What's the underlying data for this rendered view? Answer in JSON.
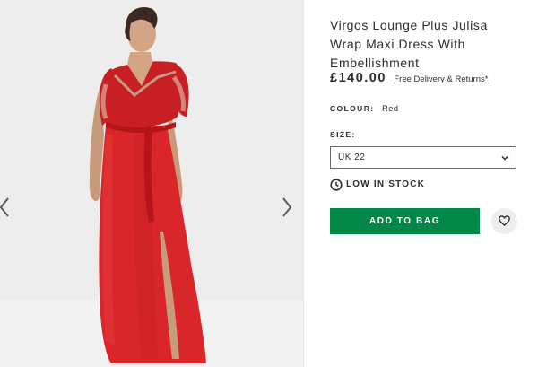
{
  "product": {
    "title": "Virgos Lounge Plus Julisa Wrap Maxi Dress With Embellishment",
    "price": "£140.00",
    "delivery_link": "Free Delivery & Returns*",
    "colour_label": "COLOUR:",
    "colour_value": "Red",
    "size_label": "SIZE:",
    "size_selected": "UK 22",
    "stock_text": "LOW IN STOCK",
    "add_to_bag": "ADD TO BAG"
  },
  "gallery": {
    "image_subject": "model-wearing-red-maxi-dress",
    "prev_icon": "chevron-left-icon",
    "next_icon": "chevron-right-icon"
  },
  "icons": {
    "size_dropdown": "chevron-down-icon",
    "stock": "clock-icon",
    "save": "heart-icon"
  },
  "colors": {
    "accent_green": "#018849",
    "dress_red": "#d8262a",
    "text": "#2d2d2d",
    "gallery_bg": "#ededed"
  }
}
